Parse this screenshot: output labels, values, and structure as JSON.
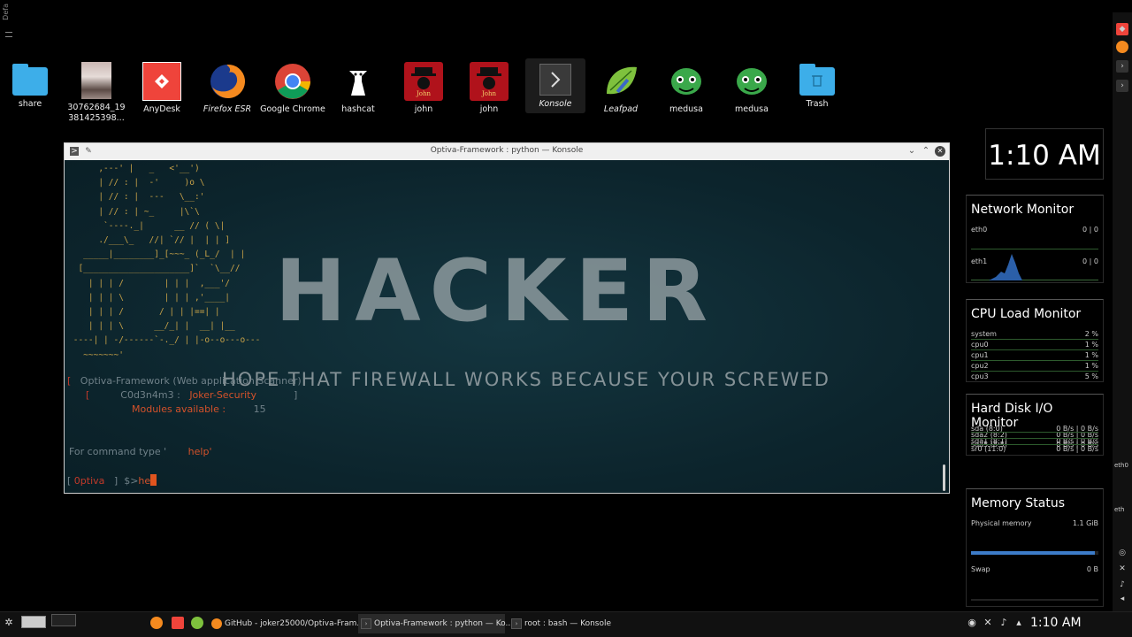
{
  "left_strip": {
    "text": "Defa"
  },
  "desktop_icons": [
    {
      "name": "share",
      "label": "share"
    },
    {
      "name": "photo",
      "label": "30762684_19 381425398..."
    },
    {
      "name": "anydesk",
      "label": "AnyDesk"
    },
    {
      "name": "firefox",
      "label": "Firefox ESR"
    },
    {
      "name": "chrome",
      "label": "Google Chrome"
    },
    {
      "name": "hashcat",
      "label": "hashcat"
    },
    {
      "name": "john1",
      "label": "john"
    },
    {
      "name": "john2",
      "label": "john"
    },
    {
      "name": "konsole",
      "label": "Konsole"
    },
    {
      "name": "leafpad",
      "label": "Leafpad"
    },
    {
      "name": "medusa1",
      "label": "medusa"
    },
    {
      "name": "medusa2",
      "label": "medusa"
    },
    {
      "name": "trash",
      "label": "Trash"
    }
  ],
  "konsole": {
    "title": "Optiva-Framework : python — Konsole",
    "ascii_art": "      ,---' |   _   <'__')\n      | // : |  -'     )o \\\n      | // : |  ---   \\__:'\n      | // : | ~_     |\\`\\\n       `----._|      __ // ( \\|\n      ./___\\_   //| `// |  | | ]\n   _____|________]_[~~~_ (_L_/  | |\n  [_____________________]`  `\\__//\n    | | | /        | | |  ,___'/\n    | | | \\        | | | ,'____|\n    | | | /       / | | |==| |\n    | | | \\      __/_| |  __| |__\n ----| | -/------`-._/ | |-o--o---o---\n   ~~~~~~~'",
    "hacker_text": "HACKER",
    "tagline": "HOPE THAT FIREWALL WORKS BECAUSE YOUR SCREWED",
    "line1_bracket": "[",
    "line1_text": "Optiva-Framework (Web application Scanner)",
    "line2_bracket_open": "[",
    "line2_label": "C0d3n4m3 :",
    "line2_value": "Joker-Security",
    "line2_bracket_close": "]",
    "line3_label": "Modules available :",
    "line3_value": "15",
    "help_prefix": "For command type '",
    "help_cmd": "help'",
    "prompt_open": "[",
    "prompt_name": "0ptiva",
    "prompt_close": "]",
    "prompt_symbol": "$>",
    "typed": "he"
  },
  "clock": {
    "time": "1:10 AM"
  },
  "network_monitor": {
    "title": "Network Monitor",
    "rows": [
      {
        "iface": "eth0",
        "value": "0 | 0"
      },
      {
        "iface": "eth1",
        "value": "0 | 0"
      }
    ]
  },
  "cpu_monitor": {
    "title": "CPU Load Monitor",
    "rows": [
      {
        "name": "system",
        "value": "2 %"
      },
      {
        "name": "cpu0",
        "value": "1 %"
      },
      {
        "name": "cpu1",
        "value": "1 %"
      },
      {
        "name": "cpu2",
        "value": "1 %"
      },
      {
        "name": "cpu3",
        "value": "5 %"
      }
    ]
  },
  "disk_monitor": {
    "title": "Hard Disk I/O Monitor",
    "rows": [
      {
        "name": "sda (8:0)",
        "value": "0 B/s | 0 B/s"
      },
      {
        "name": "sda2 (8:2)",
        "value": "0 B/s | 0 B/s"
      },
      {
        "name": "sda1 (8:1)",
        "value": "0 B/s | 0 B/s"
      },
      {
        "name": "sda5 (8:5)",
        "value": "0 B/s | 0 B/s"
      },
      {
        "name": "sr0 (11:0)",
        "value": "0 B/s | 0 B/s"
      }
    ]
  },
  "memory_status": {
    "title": "Memory Status",
    "physical_label": "Physical memory",
    "physical_value": "1.1 GiB",
    "physical_fraction": 0.97,
    "swap_label": "Swap",
    "swap_value": "0 B",
    "swap_fraction": 0
  },
  "right_panel": {
    "label1": "eth0",
    "label2": "eth"
  },
  "taskbar": {
    "tasks": [
      {
        "label": "GitHub - joker25000/Optiva-Fram...",
        "active": false
      },
      {
        "label": "Optiva-Framework : python — Ko...",
        "active": true
      },
      {
        "label": "root : bash — Konsole",
        "active": false
      }
    ],
    "clock": "1:10 AM"
  },
  "colors": {
    "accent_orange": "#e0541e",
    "prompt_red": "#c23a2a",
    "panel_blue": "#3daee9"
  }
}
